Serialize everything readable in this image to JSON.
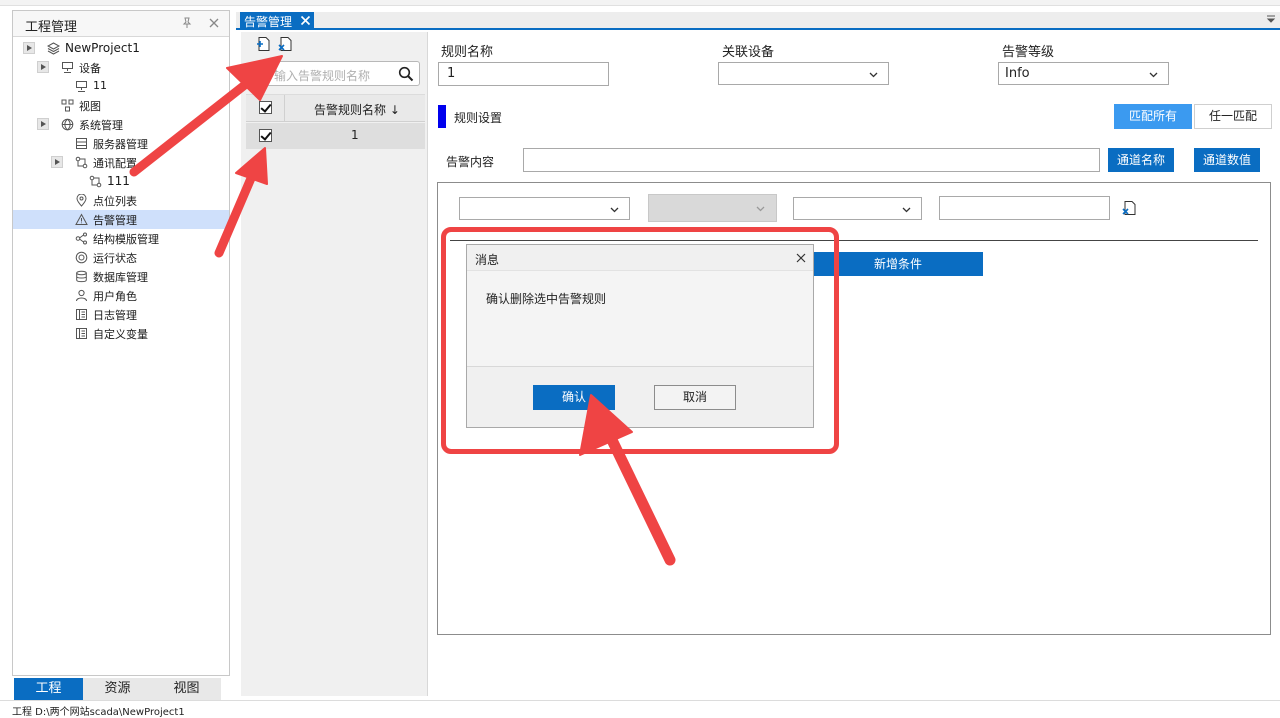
{
  "left_panel": {
    "title": "工程管理",
    "tree": [
      {
        "label": "NewProject1",
        "icon": "layers-icon"
      },
      {
        "label": "设备",
        "icon": "device-icon"
      },
      {
        "label": "11",
        "icon": "device-icon"
      },
      {
        "label": "视图",
        "icon": "view-icon"
      },
      {
        "label": "系统管理",
        "icon": "globe-icon"
      },
      {
        "label": "服务器管理",
        "icon": "server-icon"
      },
      {
        "label": "通讯配置",
        "icon": "connection-icon"
      },
      {
        "label": "111",
        "icon": "connection-icon"
      },
      {
        "label": "点位列表",
        "icon": "point-icon"
      },
      {
        "label": "告警管理",
        "icon": "alarm-icon",
        "selected": true
      },
      {
        "label": "结构模版管理",
        "icon": "structure-icon"
      },
      {
        "label": "运行状态",
        "icon": "status-icon"
      },
      {
        "label": "数据库管理",
        "icon": "database-icon"
      },
      {
        "label": "用户角色",
        "icon": "user-icon"
      },
      {
        "label": "日志管理",
        "icon": "log-icon"
      },
      {
        "label": "自定义变量",
        "icon": "variable-icon"
      }
    ],
    "bottom_tabs": [
      "工程",
      "资源",
      "视图"
    ]
  },
  "doc_tab": {
    "label": "告警管理"
  },
  "rules_list": {
    "search_placeholder": "输入告警规则名称",
    "column_header": "告警规则名称 ↓",
    "rows": [
      {
        "name": "1",
        "checked": true
      }
    ]
  },
  "form": {
    "rule_name_label": "规则名称",
    "rule_name_value": "1",
    "device_label": "关联设备",
    "device_value": "",
    "level_label": "告警等级",
    "level_value": "Info",
    "rule_settings_label": "规则设置",
    "match_all": "匹配所有",
    "match_any": "任一匹配",
    "alarm_content_label": "告警内容",
    "alarm_content_value": "",
    "channel_name_btn": "通道名称",
    "channel_value_btn": "通道数值",
    "add_condition": "新增条件"
  },
  "dialog": {
    "title": "消息",
    "message": "确认删除选中告警规则",
    "ok": "确认",
    "cancel": "取消"
  },
  "status_bar": {
    "text": "工程 D:\\两个网站scada\\NewProject1"
  },
  "colors": {
    "accent": "#0a6dc2",
    "annotation": "#ef4444",
    "selected_row": "#cfe0fb"
  }
}
